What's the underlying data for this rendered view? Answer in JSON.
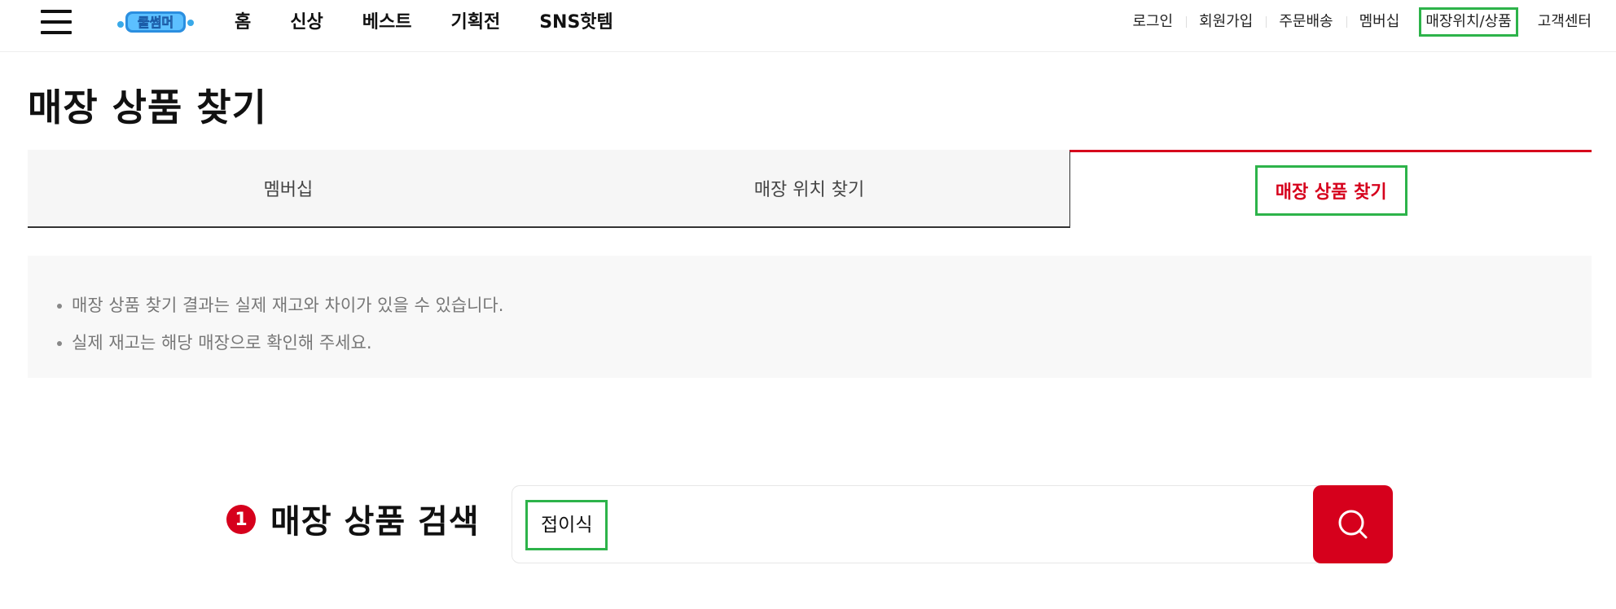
{
  "header": {
    "logo_alt": "쿨썸머",
    "nav": [
      "홈",
      "신상",
      "베스트",
      "기획전",
      "SNS핫템"
    ],
    "util": [
      "로그인",
      "회원가입",
      "주문배송",
      "멤버십",
      "매장위치/상품",
      "고객센터"
    ]
  },
  "page": {
    "title": "매장 상품 찾기"
  },
  "tabs": [
    {
      "label": "멤버십"
    },
    {
      "label": "매장 위치 찾기"
    },
    {
      "label": "매장 상품 찾기"
    }
  ],
  "notice": [
    "매장 상품 찾기 결과는 실제 재고와 차이가 있을 수 있습니다.",
    "실제 재고는 해당 매장으로 확인해 주세요."
  ],
  "search": {
    "step": "1",
    "title": "매장 상품 검색",
    "value": "접이식"
  },
  "colors": {
    "accent": "#d6001c",
    "highlight": "#2db34a"
  },
  "icons": {
    "menu": "hamburger-icon",
    "search": "search-icon"
  }
}
